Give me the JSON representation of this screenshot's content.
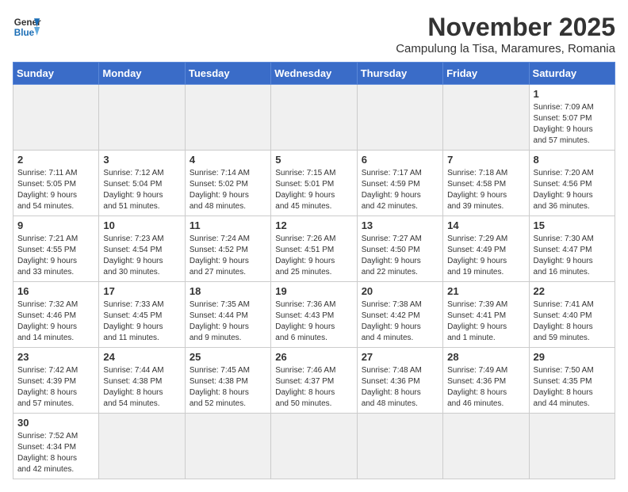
{
  "header": {
    "logo_general": "General",
    "logo_blue": "Blue",
    "month_title": "November 2025",
    "subtitle": "Campulung la Tisa, Maramures, Romania"
  },
  "weekdays": [
    "Sunday",
    "Monday",
    "Tuesday",
    "Wednesday",
    "Thursday",
    "Friday",
    "Saturday"
  ],
  "weeks": [
    [
      {
        "day": "",
        "info": ""
      },
      {
        "day": "",
        "info": ""
      },
      {
        "day": "",
        "info": ""
      },
      {
        "day": "",
        "info": ""
      },
      {
        "day": "",
        "info": ""
      },
      {
        "day": "",
        "info": ""
      },
      {
        "day": "1",
        "info": "Sunrise: 7:09 AM\nSunset: 5:07 PM\nDaylight: 9 hours\nand 57 minutes."
      }
    ],
    [
      {
        "day": "2",
        "info": "Sunrise: 7:11 AM\nSunset: 5:05 PM\nDaylight: 9 hours\nand 54 minutes."
      },
      {
        "day": "3",
        "info": "Sunrise: 7:12 AM\nSunset: 5:04 PM\nDaylight: 9 hours\nand 51 minutes."
      },
      {
        "day": "4",
        "info": "Sunrise: 7:14 AM\nSunset: 5:02 PM\nDaylight: 9 hours\nand 48 minutes."
      },
      {
        "day": "5",
        "info": "Sunrise: 7:15 AM\nSunset: 5:01 PM\nDaylight: 9 hours\nand 45 minutes."
      },
      {
        "day": "6",
        "info": "Sunrise: 7:17 AM\nSunset: 4:59 PM\nDaylight: 9 hours\nand 42 minutes."
      },
      {
        "day": "7",
        "info": "Sunrise: 7:18 AM\nSunset: 4:58 PM\nDaylight: 9 hours\nand 39 minutes."
      },
      {
        "day": "8",
        "info": "Sunrise: 7:20 AM\nSunset: 4:56 PM\nDaylight: 9 hours\nand 36 minutes."
      }
    ],
    [
      {
        "day": "9",
        "info": "Sunrise: 7:21 AM\nSunset: 4:55 PM\nDaylight: 9 hours\nand 33 minutes."
      },
      {
        "day": "10",
        "info": "Sunrise: 7:23 AM\nSunset: 4:54 PM\nDaylight: 9 hours\nand 30 minutes."
      },
      {
        "day": "11",
        "info": "Sunrise: 7:24 AM\nSunset: 4:52 PM\nDaylight: 9 hours\nand 27 minutes."
      },
      {
        "day": "12",
        "info": "Sunrise: 7:26 AM\nSunset: 4:51 PM\nDaylight: 9 hours\nand 25 minutes."
      },
      {
        "day": "13",
        "info": "Sunrise: 7:27 AM\nSunset: 4:50 PM\nDaylight: 9 hours\nand 22 minutes."
      },
      {
        "day": "14",
        "info": "Sunrise: 7:29 AM\nSunset: 4:49 PM\nDaylight: 9 hours\nand 19 minutes."
      },
      {
        "day": "15",
        "info": "Sunrise: 7:30 AM\nSunset: 4:47 PM\nDaylight: 9 hours\nand 16 minutes."
      }
    ],
    [
      {
        "day": "16",
        "info": "Sunrise: 7:32 AM\nSunset: 4:46 PM\nDaylight: 9 hours\nand 14 minutes."
      },
      {
        "day": "17",
        "info": "Sunrise: 7:33 AM\nSunset: 4:45 PM\nDaylight: 9 hours\nand 11 minutes."
      },
      {
        "day": "18",
        "info": "Sunrise: 7:35 AM\nSunset: 4:44 PM\nDaylight: 9 hours\nand 9 minutes."
      },
      {
        "day": "19",
        "info": "Sunrise: 7:36 AM\nSunset: 4:43 PM\nDaylight: 9 hours\nand 6 minutes."
      },
      {
        "day": "20",
        "info": "Sunrise: 7:38 AM\nSunset: 4:42 PM\nDaylight: 9 hours\nand 4 minutes."
      },
      {
        "day": "21",
        "info": "Sunrise: 7:39 AM\nSunset: 4:41 PM\nDaylight: 9 hours\nand 1 minute."
      },
      {
        "day": "22",
        "info": "Sunrise: 7:41 AM\nSunset: 4:40 PM\nDaylight: 8 hours\nand 59 minutes."
      }
    ],
    [
      {
        "day": "23",
        "info": "Sunrise: 7:42 AM\nSunset: 4:39 PM\nDaylight: 8 hours\nand 57 minutes."
      },
      {
        "day": "24",
        "info": "Sunrise: 7:44 AM\nSunset: 4:38 PM\nDaylight: 8 hours\nand 54 minutes."
      },
      {
        "day": "25",
        "info": "Sunrise: 7:45 AM\nSunset: 4:38 PM\nDaylight: 8 hours\nand 52 minutes."
      },
      {
        "day": "26",
        "info": "Sunrise: 7:46 AM\nSunset: 4:37 PM\nDaylight: 8 hours\nand 50 minutes."
      },
      {
        "day": "27",
        "info": "Sunrise: 7:48 AM\nSunset: 4:36 PM\nDaylight: 8 hours\nand 48 minutes."
      },
      {
        "day": "28",
        "info": "Sunrise: 7:49 AM\nSunset: 4:36 PM\nDaylight: 8 hours\nand 46 minutes."
      },
      {
        "day": "29",
        "info": "Sunrise: 7:50 AM\nSunset: 4:35 PM\nDaylight: 8 hours\nand 44 minutes."
      }
    ],
    [
      {
        "day": "30",
        "info": "Sunrise: 7:52 AM\nSunset: 4:34 PM\nDaylight: 8 hours\nand 42 minutes."
      },
      {
        "day": "",
        "info": ""
      },
      {
        "day": "",
        "info": ""
      },
      {
        "day": "",
        "info": ""
      },
      {
        "day": "",
        "info": ""
      },
      {
        "day": "",
        "info": ""
      },
      {
        "day": "",
        "info": ""
      }
    ]
  ]
}
